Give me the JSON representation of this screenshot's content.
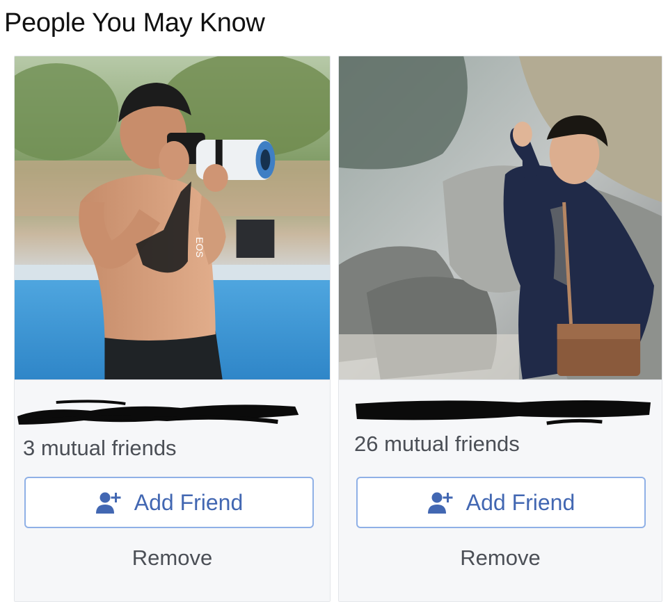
{
  "section": {
    "title": "People You May Know"
  },
  "suggestions": [
    {
      "name": "",
      "name_redacted": true,
      "mutual_friends": "3 mutual friends",
      "add_label": "Add Friend",
      "remove_label": "Remove",
      "photo_watermark": "EOS"
    },
    {
      "name": "",
      "name_redacted": true,
      "mutual_friends": "26 mutual friends",
      "add_label": "Add Friend",
      "remove_label": "Remove"
    }
  ],
  "icons": {
    "add_friend": "add-person-icon"
  },
  "colors": {
    "accent": "#4267b2",
    "button_border": "#8fb0e6",
    "info_bg": "#f6f7f9",
    "muted_text": "#4b4f56"
  }
}
